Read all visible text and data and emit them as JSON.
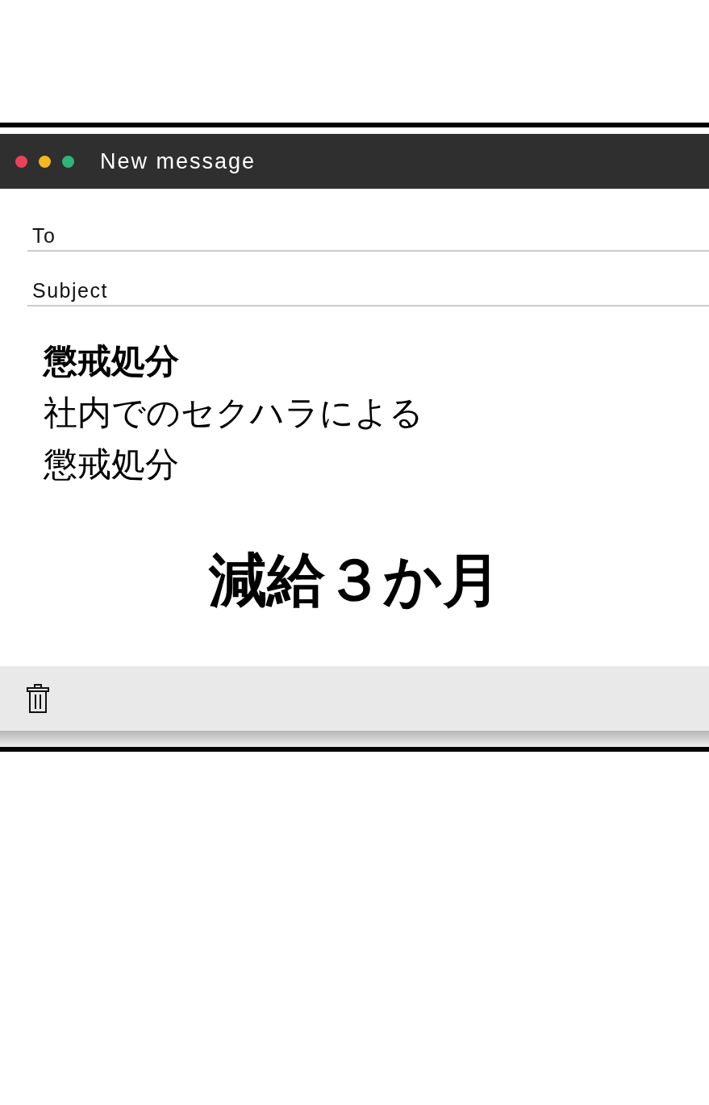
{
  "window": {
    "title": "New message"
  },
  "window_buttons": [
    {
      "color": "#e8435a"
    },
    {
      "color": "#f5b81c"
    },
    {
      "color": "#2cb67d"
    }
  ],
  "fields": [
    {
      "label": "To"
    },
    {
      "label": "Subject"
    }
  ],
  "body": {
    "heading": "懲戒処分",
    "lines": [
      "社内でのセクハラによる",
      "懲戒処分"
    ],
    "emphasis": "減給３か月"
  },
  "footer": {
    "tools": [
      {
        "kind": "trash"
      }
    ]
  }
}
